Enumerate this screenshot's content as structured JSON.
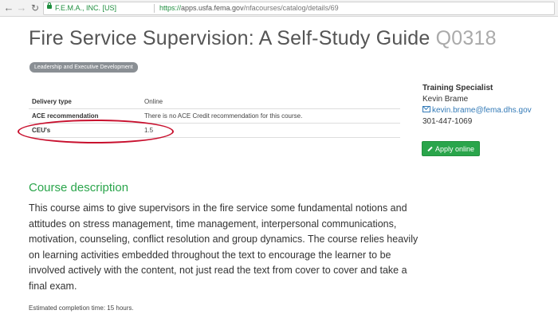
{
  "browser": {
    "nav": {
      "back": "←",
      "forward": "→",
      "reload": "↻"
    },
    "org_name": "F.E.M.A., INC. [US]",
    "url_scheme": "https://",
    "url_host": "apps.usfa.fema.gov",
    "url_path": "/nfacourses/catalog/details/69"
  },
  "course": {
    "title": "Fire Service Supervision: A Self-Study Guide",
    "code": "Q0318",
    "tag": "Leadership and Executive Development"
  },
  "details": [
    {
      "label": "Delivery type",
      "value": "Online"
    },
    {
      "label": "ACE recommendation",
      "value": "There is no ACE Credit recommendation for this course."
    },
    {
      "label": "CEU's",
      "value": "1.5"
    }
  ],
  "contact": {
    "heading": "Training Specialist",
    "name": "Kevin Brame",
    "email": "kevin.brame@fema.dhs.gov",
    "phone": "301-447-1069"
  },
  "apply_label": "Apply online",
  "description": {
    "heading": "Course description",
    "text": "This course aims to give supervisors in the fire service some fundamental notions and attitudes on stress management, time management, interpersonal communications, motivation, counseling, conflict resolution and group dynamics. The course relies heavily on learning activities embedded throughout the text to encourage the learner to be involved actively with the content, not just read the text from cover to cover and take a final exam."
  },
  "completion": "Estimated completion time: 15 hours.",
  "colors": {
    "accent": "#2aa54b",
    "link": "#337ab7",
    "highlight": "#c8102e",
    "secure": "#1e8e3e"
  },
  "icons": [
    "back-arrow-icon",
    "forward-arrow-icon",
    "reload-icon",
    "lock-icon",
    "envelope-icon",
    "pencil-icon"
  ]
}
